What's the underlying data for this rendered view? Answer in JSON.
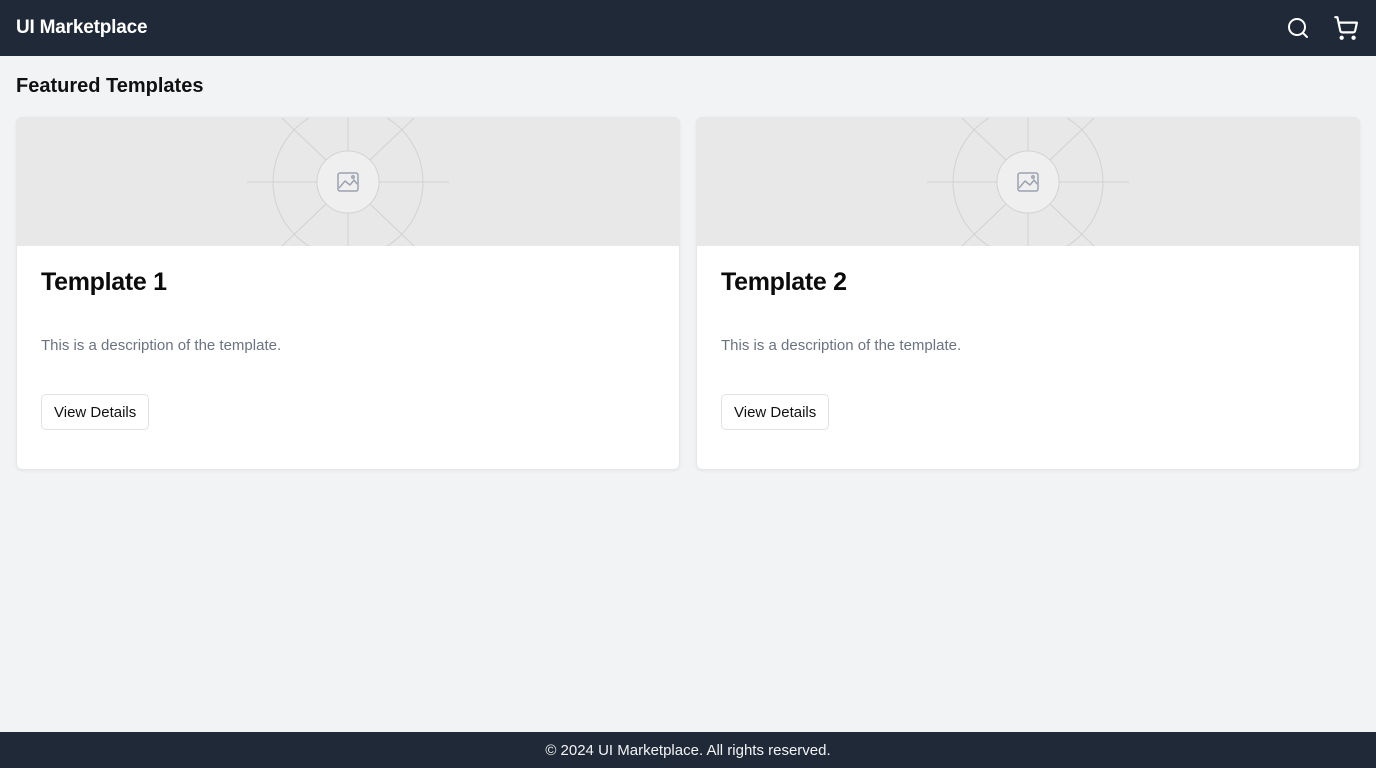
{
  "header": {
    "brand": "UI Marketplace",
    "icons": [
      "search-icon",
      "cart-icon"
    ]
  },
  "main": {
    "section_title": "Featured Templates",
    "cards": [
      {
        "title": "Template 1",
        "description": "This is a description of the template.",
        "button_label": "View Details",
        "image_icon": "image-placeholder-icon"
      },
      {
        "title": "Template 2",
        "description": "This is a description of the template.",
        "button_label": "View Details",
        "image_icon": "image-placeholder-icon"
      }
    ]
  },
  "footer": {
    "text": "© 2024 UI Marketplace. All rights reserved."
  },
  "colors": {
    "header_bg": "#1f2937",
    "page_bg": "#f2f3f5",
    "card_bg": "#ffffff",
    "muted_text": "#6b7280"
  }
}
